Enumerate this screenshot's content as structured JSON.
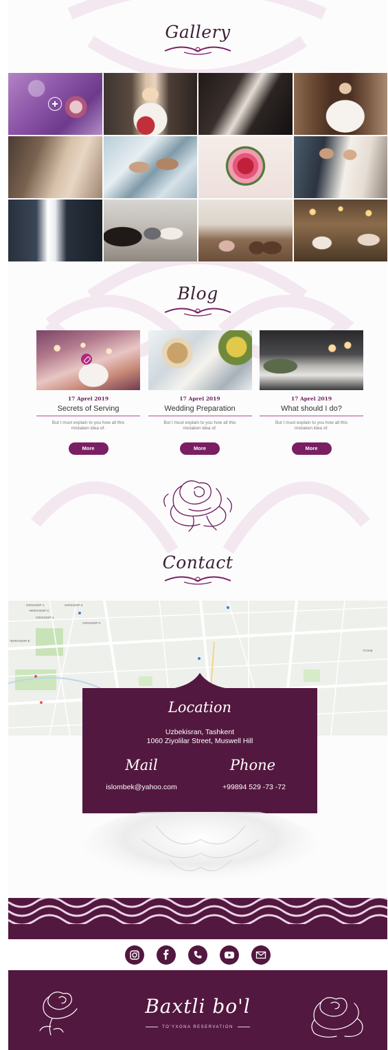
{
  "gallery": {
    "title": "Gallery"
  },
  "blog": {
    "title": "Blog",
    "posts": [
      {
        "date": "17 Aprel 2019",
        "title": "Secrets of Serving",
        "excerpt": "But I must explain to you how all this mistaken idea of.",
        "more": "More"
      },
      {
        "date": "17 Aprel 2019",
        "title": "Wedding Preparation",
        "excerpt": "But I must explain to you how all this mistaken idea of.",
        "more": "More"
      },
      {
        "date": "17 Aprel 2019",
        "title": "What should I do?",
        "excerpt": "But I must explain to you how all this mistaken idea of.",
        "more": "More"
      }
    ]
  },
  "contact": {
    "title": "Contact",
    "location_label": "Location",
    "address_line1": "Uzbekisran, Tashkent",
    "address_line2": "1060 Ziyolilar Street, Muswell Hill",
    "mail_label": "Mail",
    "email": "islombek@yahoo.com",
    "phone_label": "Phone",
    "phone": "+99894 529 -73 -72"
  },
  "map": {
    "labels": [
      "ОЛОНЗОР-1",
      "ОЛОНЗОР-3",
      "ОЛОНЗОР-4",
      "ОЛОНЗОР-2",
      "ЧИЛОНЗОР-Е",
      "ЧИЛОНЗОР-С",
      "ТАЛАБ"
    ]
  },
  "social": {
    "icons": [
      "instagram-icon",
      "facebook-icon",
      "phone-icon",
      "youtube-icon",
      "mail-icon"
    ]
  },
  "footer": {
    "brand": "Baxtli bo'l",
    "tagline": "TO'YXONA RESERVATION"
  },
  "colors": {
    "primary": "#53183f",
    "accent": "#7a1f63",
    "button": "#7a1f63",
    "title": "#3a1f33"
  }
}
